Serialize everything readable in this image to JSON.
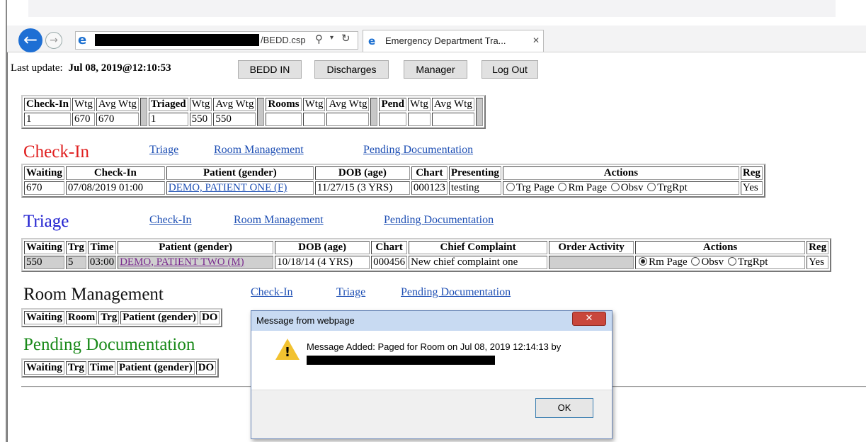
{
  "browser": {
    "url_suffix": "/BEDD.csp",
    "tab_title": "Emergency Department Tra...",
    "back_icon": "back-arrow",
    "forward_icon": "forward-arrow",
    "search_icon": "search",
    "refresh_icon": "refresh",
    "close_icon": "close-x"
  },
  "header": {
    "last_update_label": "Last update:",
    "last_update_value": "Jul 08, 2019@12:10:53",
    "buttons": [
      "BEDD IN",
      "Discharges",
      "Manager",
      "Log Out"
    ]
  },
  "summary": {
    "headers": [
      "Check-In",
      "Wtg",
      "Avg Wtg",
      "Triaged",
      "Wtg",
      "Avg Wtg",
      "Rooms",
      "Wtg",
      "Avg Wtg",
      "Pend",
      "Wtg",
      "Avg Wtg"
    ],
    "values": [
      "1",
      "670",
      "670",
      "1",
      "550",
      "550",
      "",
      "",
      "",
      "",
      "",
      ""
    ]
  },
  "checkin": {
    "title": "Check-In",
    "title_color": "#e02020",
    "links": [
      "Triage",
      "Room Management",
      "Pending Documentation"
    ],
    "columns": [
      "Waiting",
      "Check-In",
      "Patient (gender)",
      "DOB (age)",
      "Chart",
      "Presenting",
      "Actions",
      "Reg"
    ],
    "row": {
      "waiting": "670",
      "checkin": "07/08/2019 01:00",
      "patient": "DEMO, PATIENT ONE (F)",
      "dob": "11/27/15 (3 YRS)",
      "chart": "000123",
      "presenting": "testing",
      "actions": [
        "Trg Page",
        "Rm Page",
        "Obsv",
        "TrgRpt"
      ],
      "reg": "Yes"
    }
  },
  "triage": {
    "title": "Triage",
    "title_color": "#2020d0",
    "links": [
      "Check-In",
      "Room Management",
      "Pending Documentation"
    ],
    "columns": [
      "Waiting",
      "Trg",
      "Time",
      "Patient (gender)",
      "DOB (age)",
      "Chart",
      "Chief Complaint",
      "Order Activity",
      "Actions",
      "Reg"
    ],
    "row": {
      "waiting": "550",
      "trg": "5",
      "time": "03:00",
      "patient": "DEMO, PATIENT TWO (M)",
      "dob": "10/18/14 (4 YRS)",
      "chart": "000456",
      "complaint": "New chief complaint one",
      "order": "",
      "actions": [
        "Rm Page",
        "Obsv",
        "TrgRpt"
      ],
      "reg": "Yes"
    }
  },
  "rooms": {
    "title": "Room Management",
    "links": [
      "Check-In",
      "Triage",
      "Pending Documentation"
    ],
    "columns": [
      "Waiting",
      "Room",
      "Trg",
      "Patient (gender)",
      "DO"
    ]
  },
  "pending": {
    "title": "Pending Documentation",
    "title_color": "#1a8a1a",
    "columns": [
      "Waiting",
      "Trg",
      "Time",
      "Patient (gender)",
      "DO"
    ]
  },
  "dialog": {
    "title": "Message from webpage",
    "message": "Message Added: Paged for Room on Jul 08, 2019 12:14:13 by",
    "ok": "OK",
    "icon": "warning"
  }
}
